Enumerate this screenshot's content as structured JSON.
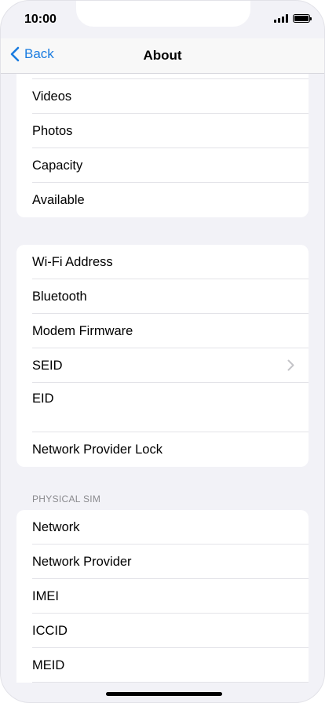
{
  "status_bar": {
    "time": "10:00"
  },
  "nav": {
    "back_label": "Back",
    "title": "About"
  },
  "group1": {
    "rows": [
      "Videos",
      "Photos",
      "Capacity",
      "Available"
    ]
  },
  "group2": {
    "rows": [
      "Wi-Fi Address",
      "Bluetooth",
      "Modem Firmware",
      "SEID",
      "EID",
      "Network Provider Lock"
    ]
  },
  "physical_sim": {
    "header": "PHYSICAL SIM",
    "rows": [
      "Network",
      "Network Provider",
      "IMEI",
      "ICCID",
      "MEID"
    ]
  },
  "colors": {
    "accent": "#1a7ce0",
    "background": "#f2f2f7"
  }
}
